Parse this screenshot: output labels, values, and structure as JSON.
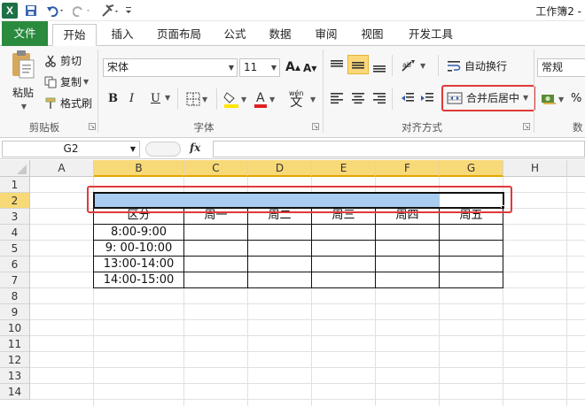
{
  "window": {
    "title": "工作簿2 -"
  },
  "quick_access": {
    "app_icon": "X"
  },
  "tabs": [
    "文件",
    "开始",
    "插入",
    "页面布局",
    "公式",
    "数据",
    "审阅",
    "视图",
    "开发工具"
  ],
  "clipboard": {
    "paste": "粘贴",
    "cut": "剪切",
    "copy": "复制",
    "format_painter": "格式刷",
    "group": "剪贴板"
  },
  "font": {
    "name": "宋体",
    "size": "11",
    "group": "字体",
    "bold": "B",
    "italic": "I",
    "underline": "U",
    "wen": "wén",
    "wen_char": "文"
  },
  "alignment": {
    "wrap": "自动换行",
    "merge": "合并后居中",
    "group": "对齐方式"
  },
  "number": {
    "format": "常规",
    "percent": "%",
    "group_partial": "数"
  },
  "namebox": "G2",
  "fx": "fx",
  "columns": [
    "A",
    "B",
    "C",
    "D",
    "E",
    "F",
    "G",
    "H"
  ],
  "rows": [
    "1",
    "2",
    "3",
    "4",
    "5",
    "6",
    "7",
    "8",
    "9",
    "10",
    "11",
    "12",
    "13",
    "14"
  ],
  "table": {
    "header": [
      "区分",
      "周一",
      "周二",
      "周三",
      "周四",
      "周五"
    ],
    "times": [
      "8:00-9:00",
      "9: 00-10:00",
      "13:00-14:00",
      "14:00-15:00"
    ]
  },
  "colors": {
    "accent": "#2a8a3e",
    "selection": "#a8cdf0",
    "highlight": "#e03a3a"
  }
}
